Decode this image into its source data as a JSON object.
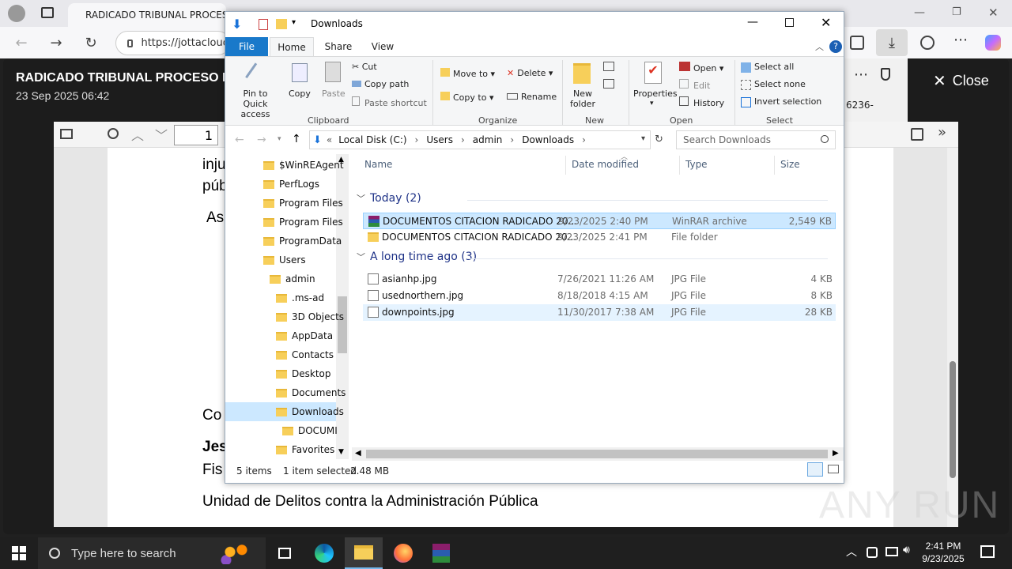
{
  "browser": {
    "tab_title": "RADICADO TRIBUNAL PROCESO NO",
    "url": "https://jottacloud",
    "window_controls": [
      "—",
      "❐",
      "✕"
    ]
  },
  "viewer": {
    "title": "RADICADO TRIBUNAL PROCESO N",
    "date": "23 Sep 2025 06:42",
    "close_label": "Close",
    "page_number": "1",
    "side_text": "6236-"
  },
  "pdf": {
    "lines": [
      "inju",
      "púb",
      "As",
      "Co",
      "Jes",
      "Fis",
      "Unidad de Delitos contra la Administración Pública"
    ]
  },
  "explorer": {
    "title": "Downloads",
    "tabs": [
      "File",
      "Home",
      "Share",
      "View"
    ],
    "ribbon": {
      "clipboard": {
        "pin": "Pin to Quick access",
        "copy": "Copy",
        "paste": "Paste",
        "cut": "Cut",
        "copy_path": "Copy path",
        "paste_shortcut": "Paste shortcut",
        "label": "Clipboard"
      },
      "organize": {
        "move_to": "Move to",
        "copy_to": "Copy to",
        "delete": "Delete",
        "rename": "Rename",
        "label": "Organize"
      },
      "new": {
        "new_folder": "New folder",
        "label": "New"
      },
      "open": {
        "properties": "Properties",
        "open": "Open",
        "edit": "Edit",
        "history": "History",
        "label": "Open"
      },
      "select": {
        "select_all": "Select all",
        "select_none": "Select none",
        "invert": "Invert selection",
        "label": "Select"
      }
    },
    "path": [
      "«",
      "Local Disk (C:)",
      "Users",
      "admin",
      "Downloads"
    ],
    "search_placeholder": "Search Downloads",
    "tree": [
      {
        "label": "$WinREAgent",
        "indent": 0
      },
      {
        "label": "PerfLogs",
        "indent": 0
      },
      {
        "label": "Program Files",
        "indent": 0
      },
      {
        "label": "Program Files",
        "indent": 0
      },
      {
        "label": "ProgramData",
        "indent": 0
      },
      {
        "label": "Users",
        "indent": 0
      },
      {
        "label": "admin",
        "indent": 1
      },
      {
        "label": ".ms-ad",
        "indent": 2
      },
      {
        "label": "3D Objects",
        "indent": 2
      },
      {
        "label": "AppData",
        "indent": 2
      },
      {
        "label": "Contacts",
        "indent": 2
      },
      {
        "label": "Desktop",
        "indent": 2
      },
      {
        "label": "Documents",
        "indent": 2
      },
      {
        "label": "Downloads",
        "indent": 2
      },
      {
        "label": "DOCUMI",
        "indent": 3
      },
      {
        "label": "Favorites",
        "indent": 2
      }
    ],
    "columns": [
      "Name",
      "Date modified",
      "Type",
      "Size"
    ],
    "groups": [
      {
        "title": "Today (2)",
        "rows": [
          {
            "name": "DOCUMENTOS CITACION RADICADO 20...",
            "date": "9/23/2025 2:40 PM",
            "type": "WinRAR archive",
            "size": "2,549 KB",
            "icon": "winrar-icon",
            "state": "selected"
          },
          {
            "name": "DOCUMENTOS CITACION RADICADO 20...",
            "date": "9/23/2025 2:41 PM",
            "type": "File folder",
            "size": "",
            "icon": "folder-icon",
            "state": ""
          }
        ]
      },
      {
        "title": "A long time ago (3)",
        "rows": [
          {
            "name": "asianhp.jpg",
            "date": "7/26/2021 11:26 AM",
            "type": "JPG File",
            "size": "4 KB",
            "icon": "jpg-file-icon",
            "state": ""
          },
          {
            "name": "usednorthern.jpg",
            "date": "8/18/2018 4:15 AM",
            "type": "JPG File",
            "size": "8 KB",
            "icon": "jpg-file-icon",
            "state": ""
          },
          {
            "name": "downpoints.jpg",
            "date": "11/30/2017 7:38 AM",
            "type": "JPG File",
            "size": "28 KB",
            "icon": "jpg-file-icon",
            "state": "hover"
          }
        ]
      }
    ],
    "status": {
      "items": "5 items",
      "selected": "1 item selected",
      "size": "2.48 MB"
    }
  },
  "taskbar": {
    "search_placeholder": "Type here to search",
    "time": "2:41 PM",
    "date": "9/23/2025"
  },
  "watermark": "ANY RUN"
}
